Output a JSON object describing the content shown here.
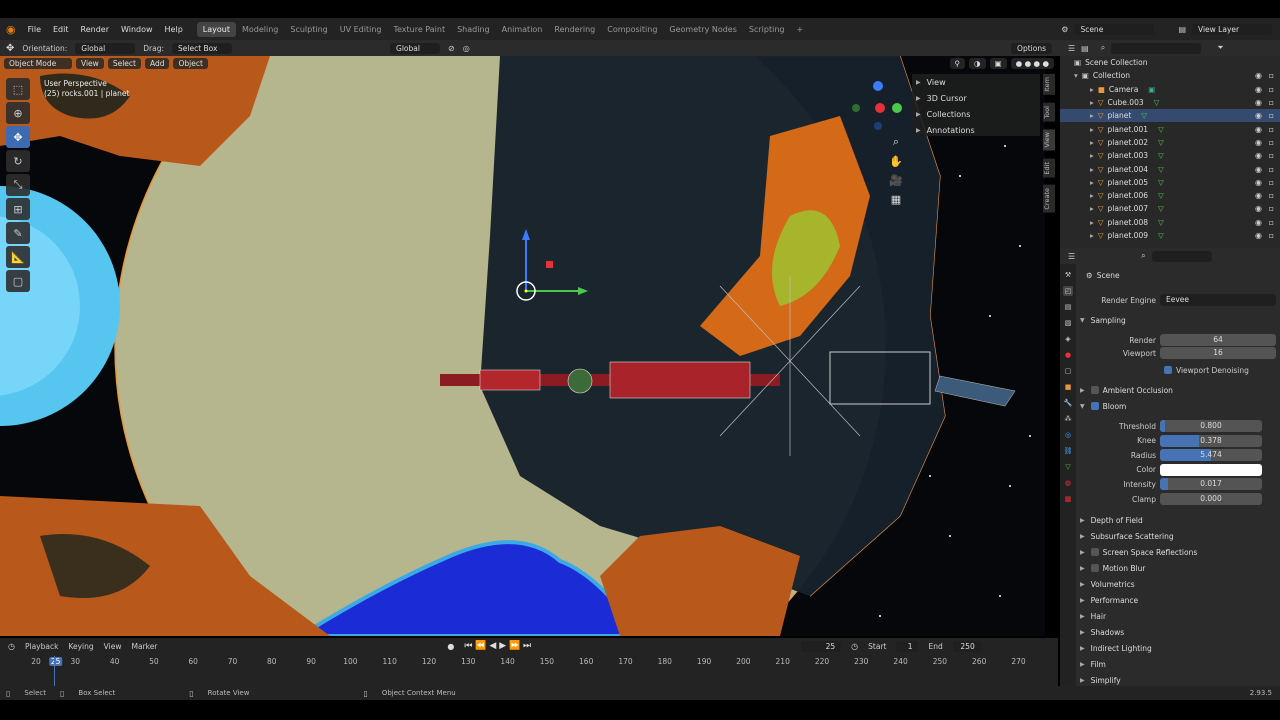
{
  "menu": [
    "File",
    "Edit",
    "Render",
    "Window",
    "Help"
  ],
  "workspaces": [
    "Layout",
    "Modeling",
    "Sculpting",
    "UV Editing",
    "Texture Paint",
    "Shading",
    "Animation",
    "Rendering",
    "Compositing",
    "Geometry Nodes",
    "Scripting"
  ],
  "workspace_add": "+",
  "active_workspace": "Layout",
  "scene": "Scene",
  "view_layer": "View Layer",
  "tool_header": {
    "orientation_label": "Orientation:",
    "orientation": "Global",
    "drag_label": "Drag:",
    "drag": "Select Box",
    "pivot": "Global",
    "options": "Options"
  },
  "viewport_header": {
    "mode": "Object Mode",
    "view": "View",
    "select": "Select",
    "add": "Add",
    "object": "Object"
  },
  "viewport_info": {
    "perspective": "User Perspective",
    "object": "(25) rocks.001 | planet"
  },
  "npanel": [
    "View",
    "3D Cursor",
    "Collections",
    "Annotations"
  ],
  "side_tabs": [
    "Item",
    "Tool",
    "View",
    "Edit",
    "Create"
  ],
  "outliner": {
    "root": "Scene Collection",
    "collection": "Collection",
    "items": [
      "Camera",
      "Cube.003",
      "planet",
      "planet.001",
      "planet.002",
      "planet.003",
      "planet.004",
      "planet.005",
      "planet.006",
      "planet.007",
      "planet.008",
      "planet.009"
    ],
    "selected": "planet"
  },
  "properties": {
    "context": "Scene",
    "render_engine_label": "Render Engine",
    "render_engine": "Eevee",
    "sampling": "Sampling",
    "render_label": "Render",
    "render": "64",
    "viewport_label": "Viewport",
    "viewport": "16",
    "viewport_denoising": "Viewport Denoising",
    "ambient_occlusion": "Ambient Occlusion",
    "bloom": "Bloom",
    "bloom_fields": [
      {
        "label": "Threshold",
        "value": "0.800",
        "fill": 0.05
      },
      {
        "label": "Knee",
        "value": "0.378",
        "fill": 0.38
      },
      {
        "label": "Radius",
        "value": "5.474",
        "fill": 0.5
      },
      {
        "label": "Color",
        "value": "",
        "fill": 0
      },
      {
        "label": "Intensity",
        "value": "0.017",
        "fill": 0.08
      },
      {
        "label": "Clamp",
        "value": "0.000",
        "fill": 0
      }
    ],
    "sections": [
      "Depth of Field",
      "Subsurface Scattering",
      "Screen Space Reflections",
      "Motion Blur",
      "Volumetrics",
      "Performance",
      "Hair",
      "Shadows",
      "Indirect Lighting",
      "Film",
      "Simplify"
    ],
    "checkbox_sections": [
      "Screen Space Reflections",
      "Motion Blur"
    ]
  },
  "timeline": {
    "playback": "Playback",
    "keying": "Keying",
    "view": "View",
    "marker": "Marker",
    "current_frame": "25",
    "start_label": "Start",
    "start": "1",
    "end_label": "End",
    "end": "250",
    "ticks": [
      "20",
      "25",
      "30",
      "40",
      "50",
      "60",
      "70",
      "80",
      "90",
      "100",
      "110",
      "120",
      "130",
      "140",
      "150",
      "160",
      "170",
      "180",
      "190",
      "200",
      "210",
      "220",
      "230",
      "240",
      "250",
      "260",
      "270"
    ]
  },
  "status": {
    "select": "Select",
    "box_select": "Box Select",
    "rotate_view": "Rotate View",
    "context_menu": "Object Context Menu",
    "version": "2.93.5"
  }
}
